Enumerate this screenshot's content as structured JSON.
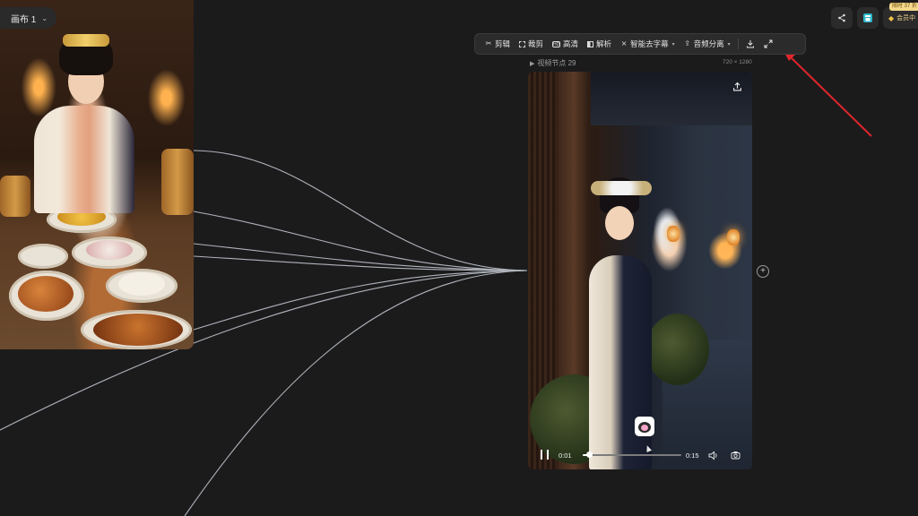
{
  "canvas_tab": {
    "label": "画布 1"
  },
  "toolbar": {
    "items": [
      {
        "label": "剪辑",
        "icon": "scissors-icon"
      },
      {
        "label": "裁剪",
        "icon": "crop-icon"
      },
      {
        "label": "高清",
        "icon": "hd-icon"
      },
      {
        "label": "解析",
        "icon": "analyze-icon"
      },
      {
        "label": "智能去字幕",
        "icon": "remove-subtitle-icon"
      },
      {
        "label": "音频分离",
        "icon": "audio-split-icon"
      }
    ],
    "download_icon": "download-icon",
    "expand_icon": "expand-icon"
  },
  "top_right": {
    "share_icon": "share-icon",
    "store_icon": "store-icon",
    "vip_label": "会员中",
    "promo_label": "限时 37 折"
  },
  "video_node": {
    "title": "视频节点 29",
    "dimensions": "720 × 1280",
    "current_time": "0:01",
    "total_time": "0:15",
    "progress": 0.07
  },
  "colors": {
    "background": "#1b1b1c",
    "toolbar_bg": "#2b2b2c",
    "link_stroke": "#c9ced6",
    "annotation_arrow": "#e0262b",
    "vip_gold": "#f0d28a"
  }
}
